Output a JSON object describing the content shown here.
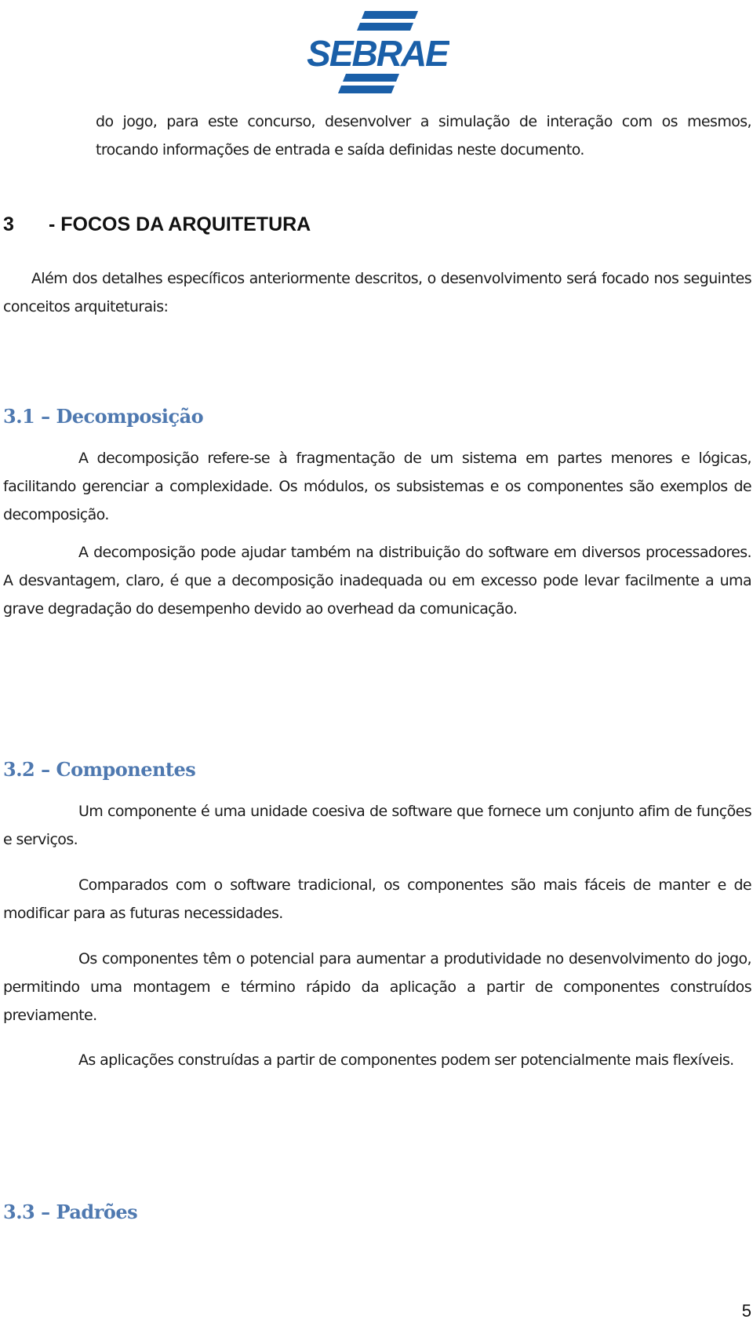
{
  "header": {
    "logo_text": "SEBRAE",
    "brand_color": "#1a5fa8"
  },
  "intro": {
    "text": "do jogo, para este concurso, desenvolver a simulação de interação com os mesmos, trocando informações de entrada e saída definidas neste documento."
  },
  "section3": {
    "number": "3",
    "title": "- FOCOS DA ARQUITETURA",
    "intro": "Além dos detalhes específicos anteriormente descritos, o desenvolvimento será focado nos seguintes conceitos arquiteturais:"
  },
  "section3_1": {
    "title": "3.1 – Decomposição",
    "paragraphs": [
      "A decomposição refere-se à fragmentação de um sistema em partes menores e lógicas, facilitando gerenciar a complexidade. Os módulos, os subsistemas e os componentes são exemplos de decomposição.",
      "A decomposição pode ajudar também na distribuição do software em diversos processadores. A desvantagem, claro, é que a decomposição inadequada ou em excesso pode levar facilmente a uma grave degradação do desempenho devido ao overhead da comunicação."
    ]
  },
  "section3_2": {
    "title": "3.2 – Componentes",
    "paragraphs": [
      "Um componente é uma unidade coesiva de software que fornece um conjunto afim de funções e serviços.",
      "Comparados com o software tradicional, os componentes são mais fáceis de manter e de modificar para as futuras necessidades.",
      "Os componentes têm o potencial para aumentar a produtividade no desenvolvimento do jogo, permitindo uma montagem e término rápido da aplicação a partir de componentes construídos previamente.",
      "As aplicações construídas a partir de componentes podem ser potencialmente mais flexíveis."
    ]
  },
  "section3_3": {
    "title": "3.3 – Padrões"
  },
  "footer": {
    "page_number": "5"
  },
  "colors": {
    "heading_blue": "#4f79b0",
    "text": "#1a1a1a"
  }
}
